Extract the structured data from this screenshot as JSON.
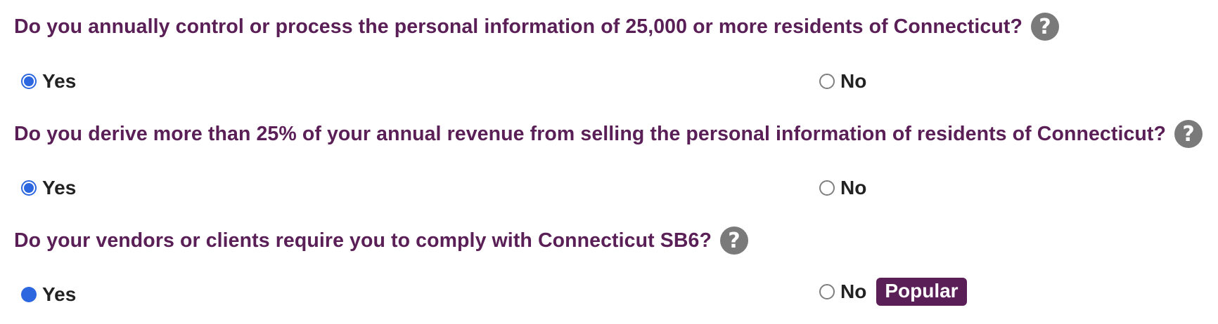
{
  "questions": [
    {
      "text": "Do you annually control or process the personal information of 25,000 or more residents of Connecticut?",
      "help": "?",
      "options": [
        {
          "label": "Yes",
          "selected": true
        },
        {
          "label": "No",
          "selected": false
        }
      ]
    },
    {
      "text": "Do you derive more than 25% of your annual revenue from selling the personal information of residents of Connecticut?",
      "help": "?",
      "options": [
        {
          "label": "Yes",
          "selected": true
        },
        {
          "label": "No",
          "selected": false
        }
      ]
    },
    {
      "text": "Do your vendors or clients require you to comply with Connecticut SB6?",
      "help": "?",
      "options": [
        {
          "label": "Yes",
          "selected": true
        },
        {
          "label": "No",
          "selected": false,
          "badge": "Popular"
        }
      ]
    }
  ],
  "colors": {
    "question_text": "#5a1f56",
    "radio_selected": "#2c67e0",
    "help_icon": "#7a7a7a",
    "badge_bg": "#5a1f56"
  }
}
